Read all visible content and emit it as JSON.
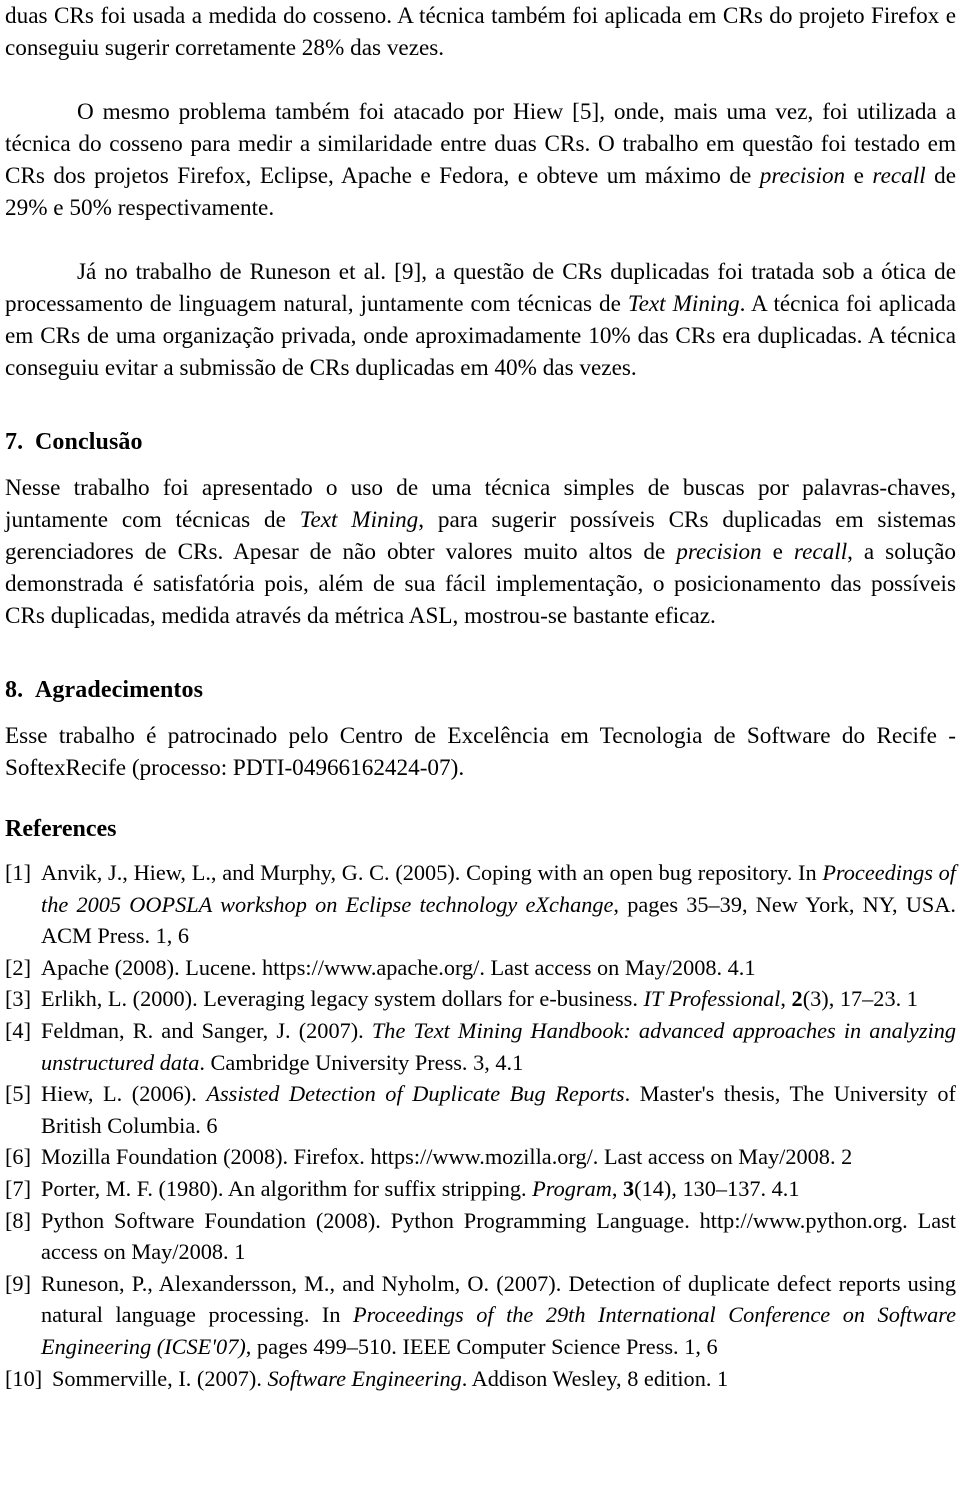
{
  "document": {
    "language": "pt-BR",
    "page_type": "academic-paper-page"
  },
  "body_top": {
    "para_continuation": "duas CRs foi usada a medida do cosseno. A técnica também foi aplicada em CRs do projeto Firefox e conseguiu sugerir corretamente 28% das vezes.",
    "para_hiew_part1": "O mesmo problema também foi atacado por Hiew [5], onde, mais uma vez, foi utilizada a técnica do cosseno para medir a similaridade entre duas CRs. O trabalho em questão foi testado em CRs dos projetos Firefox, Eclipse, Apache e Fedora, e obteve um máximo de ",
    "para_hiew_it1": "precision",
    "para_hiew_mid": " e ",
    "para_hiew_it2": "recall",
    "para_hiew_part2": " de 29% e 50% respectivamente.",
    "para_runeson_part1": "Já no trabalho de Runeson et al. [9], a questão de CRs duplicadas foi tratada sob a ótica de processamento de linguagem natural, juntamente com técnicas de ",
    "para_runeson_it1": "Text Mining",
    "para_runeson_part2": ". A técnica foi aplicada em CRs de uma organização privada, onde aproximadamente 10% das CRs era duplicadas. A técnica conseguiu evitar a submissão de CRs duplicadas em 40% das vezes."
  },
  "section_conclusao": {
    "number": "7.",
    "title": "Conclusão",
    "para_part1": "Nesse trabalho foi apresentado o uso de uma técnica simples de buscas por palavras-chaves, juntamente com técnicas de ",
    "para_it1": "Text Mining",
    "para_part2": ", para sugerir possíveis CRs duplicadas em sistemas gerenciadores de CRs. Apesar de não obter valores muito altos de ",
    "para_it2": "precision",
    "para_part3": " e ",
    "para_it3": "recall",
    "para_part4": ", a solução demonstrada é satisfatória pois, além de sua fácil implementação, o posicionamento das possíveis CRs duplicadas, medida através da métrica ASL, mostrou-se bastante eficaz."
  },
  "section_agradecimentos": {
    "number": "8.",
    "title": "Agradecimentos",
    "para": "Esse trabalho é patrocinado pelo Centro de Excelência em Tecnologia de Software do Recife - SoftexRecife (processo: PDTI-04966162424-07)."
  },
  "references": {
    "heading": "References",
    "items": [
      {
        "label": "[1]",
        "part1": "Anvik, J., Hiew, L., and Murphy, G. C. (2005). Coping with an open bug repository. In ",
        "italic1": "Proceedings of the 2005 OOPSLA workshop on Eclipse technology eXchange",
        "part2": ", pages 35–39, New York, NY, USA. ACM Press. 1, 6"
      },
      {
        "label": "[2]",
        "part1": "Apache (2008). Lucene. https://www.apache.org/. Last access on May/2008. 4.1",
        "italic1": "",
        "part2": ""
      },
      {
        "label": "[3]",
        "part1": "Erlikh, L. (2000). Leveraging legacy system dollars for e-business. ",
        "italic1": "IT Professional",
        "part2": ", ",
        "bold1": "2",
        "part3": "(3), 17–23. 1"
      },
      {
        "label": "[4]",
        "part1": "Feldman, R. and Sanger, J. (2007). ",
        "italic1": "The Text Mining Handbook: advanced approaches in analyzing unstructured data",
        "part2": ". Cambridge University Press. 3, 4.1"
      },
      {
        "label": "[5]",
        "part1": "Hiew, L. (2006). ",
        "italic1": "Assisted Detection of Duplicate Bug Reports",
        "part2": ". Master's thesis, The University of British Columbia. 6"
      },
      {
        "label": "[6]",
        "part1": "Mozilla Foundation (2008). Firefox. https://www.mozilla.org/. Last access on May/2008. 2",
        "italic1": "",
        "part2": ""
      },
      {
        "label": "[7]",
        "part1": "Porter, M. F. (1980). An algorithm for suffix stripping. ",
        "italic1": "Program",
        "part2": ", ",
        "bold1": "3",
        "part3": "(14), 130–137. 4.1"
      },
      {
        "label": "[8]",
        "part1": "Python Software Foundation (2008). Python Programming Language. http://www.python.org. Last access on May/2008. 1",
        "italic1": "",
        "part2": ""
      },
      {
        "label": "[9]",
        "part1": "Runeson, P., Alexandersson, M., and Nyholm, O. (2007). Detection of duplicate defect reports using natural language processing. In ",
        "italic1": "Proceedings of the 29th International Conference on Software Engineering (ICSE'07)",
        "part2": ", pages 499–510. IEEE Computer Science Press. 1, 6"
      },
      {
        "label": "[10]",
        "part1": "Sommerville, I. (2007). ",
        "italic1": "Software Engineering",
        "part2": ". Addison Wesley, 8 edition. 1"
      }
    ]
  }
}
